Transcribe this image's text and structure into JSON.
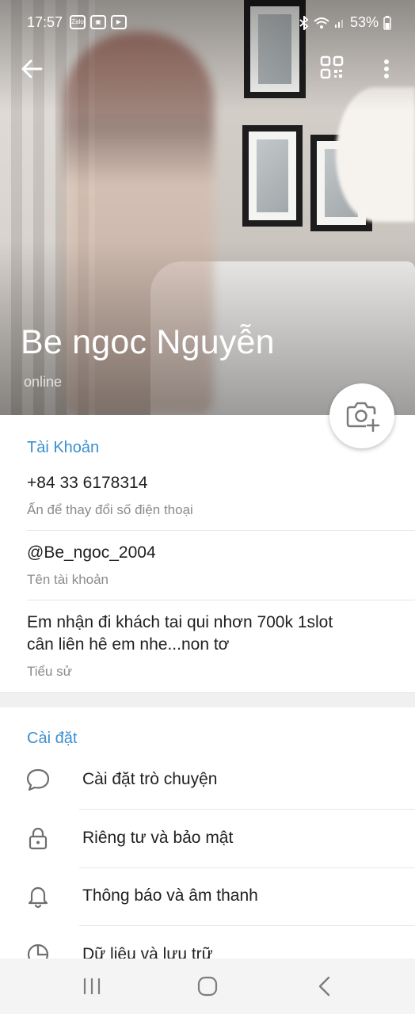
{
  "status_bar": {
    "time": "17:57",
    "app_icons": [
      "Zalo",
      "gallery-icon",
      "video-icon"
    ],
    "battery": "53%"
  },
  "profile": {
    "name": "Be ngoc Nguyễn",
    "status": "online"
  },
  "account": {
    "title": "Tài Khoản",
    "phone": "+84 33 6178314",
    "phone_hint": "Ấn để thay đổi số điện thoại",
    "username": "@Be_ngoc_2004",
    "username_hint": "Tên tài khoản",
    "bio_line1": "Em nhận đi khách tai qui nhơn 700k 1slot",
    "bio_line2": "cân liên hê em nhe...non tơ",
    "bio_hint": "Tiểu sử"
  },
  "settings": {
    "title": "Cài đặt",
    "items": [
      {
        "label": "Cài đặt trò chuyện",
        "icon": "chat-bubble-icon"
      },
      {
        "label": "Riêng tư và bảo mật",
        "icon": "lock-icon"
      },
      {
        "label": "Thông báo và âm thanh",
        "icon": "bell-icon"
      },
      {
        "label": "Dữ liệu và lưu trữ",
        "icon": "pie-chart-icon"
      }
    ]
  },
  "colors": {
    "accent": "#3a8fd0",
    "text": "#1f1f1f",
    "subtext": "#8b8b8b"
  }
}
